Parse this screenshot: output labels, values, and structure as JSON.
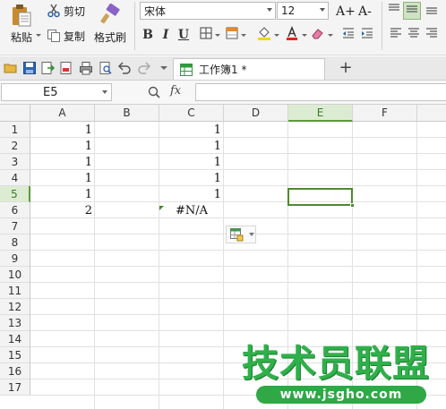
{
  "ribbon": {
    "paste_label": "粘贴",
    "cut_label": "剪切",
    "copy_label": "复制",
    "format_painter_label": "格式刷",
    "font_name": "宋体",
    "font_size": "12",
    "grow_font_label": "A+",
    "shrink_font_label": "A-",
    "bold_label": "B",
    "italic_label": "I",
    "underline_label": "U",
    "font_color": "#e8221b",
    "fill_color": "#f2d81a"
  },
  "quickbar": {
    "document_tab_label": "工作簿1 *",
    "new_tab_label": "+"
  },
  "formula_bar": {
    "name_box_value": "E5",
    "fx_label": "fx",
    "formula_value": ""
  },
  "sheet": {
    "columns": [
      "A",
      "B",
      "C",
      "D",
      "E",
      "F"
    ],
    "active_column": "E",
    "rows": [
      "1",
      "2",
      "3",
      "4",
      "5",
      "6",
      "7",
      "8",
      "9",
      "10",
      "11",
      "12",
      "13",
      "14",
      "15",
      "16",
      "17"
    ],
    "active_row": "5",
    "cells": {
      "A1": "1",
      "A2": "1",
      "A3": "1",
      "A4": "1",
      "A5": "1",
      "A6": "2",
      "C1": "1",
      "C2": "1",
      "C3": "1",
      "C4": "1",
      "C5": "1",
      "C6": "#N/A"
    },
    "selected_cell": "E5"
  },
  "watermark": {
    "title": "技术员联盟",
    "url": "www.jsgho.com"
  },
  "colors": {
    "accent_green": "#4f8a2e",
    "header_active_bg": "#dcecd2"
  }
}
